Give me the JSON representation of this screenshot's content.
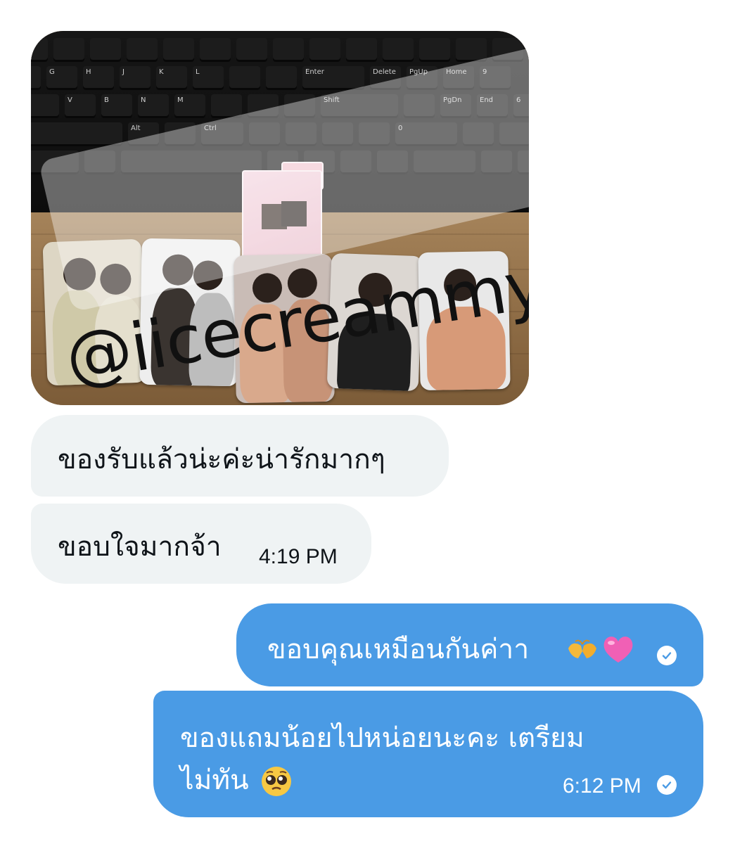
{
  "photo": {
    "watermark": "@iicecreammyy",
    "keys_row1": [
      "G",
      "H",
      "J",
      "K",
      "L",
      "Enter",
      "Delete",
      "PgUp",
      "Home",
      "9"
    ],
    "keys_row2": [
      "V",
      "B",
      "N",
      "M",
      "Shift",
      "PgDn",
      "End",
      "6"
    ],
    "keys_row3": [
      "Alt",
      "Ctrl",
      "0"
    ]
  },
  "messages": {
    "received": [
      {
        "text": "ของรับแล้วน่ะค่ะน่ารักมากๆ"
      },
      {
        "text": "ขอบใจมากจ้า",
        "time": "4:19 PM"
      }
    ],
    "sent": [
      {
        "text": "ขอบคุณเหมือนกันค่าา",
        "emojis": [
          "heart-hands-emoji",
          "pink-heart-emoji"
        ]
      },
      {
        "line1": "ของแถมน้อยไปหน่อยนะคะ เตรียม",
        "line2": "ไม่ทัน",
        "emoji": "pleading-face-emoji",
        "time": "6:12 PM"
      }
    ]
  },
  "colors": {
    "sent_bubble": "#4a9be5",
    "received_bubble": "#eff3f4",
    "text_dark": "#0f1419"
  }
}
